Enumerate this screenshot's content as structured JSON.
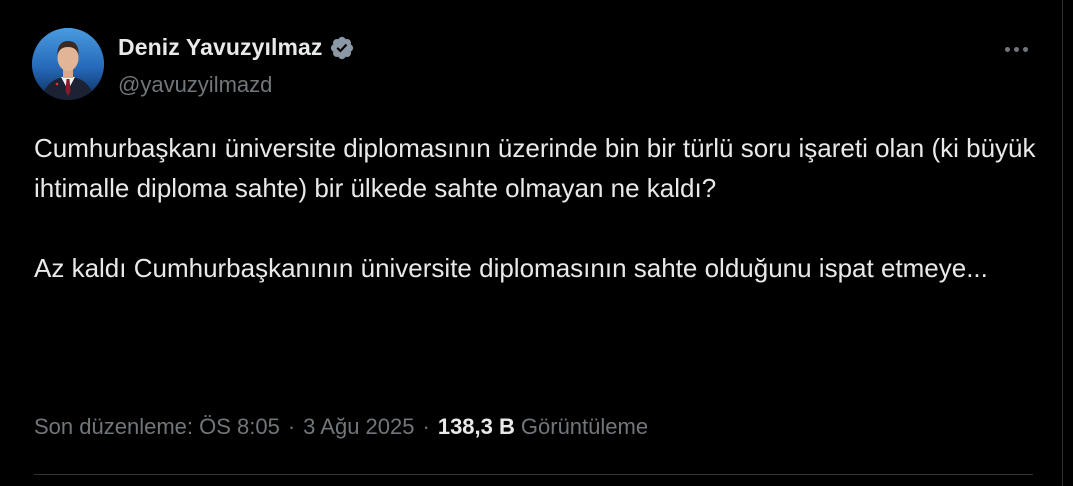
{
  "author": {
    "display_name": "Deniz Yavuzyılmaz",
    "handle": "@yavuzyilmazd",
    "verified": true
  },
  "icons": {
    "avatar": "profile-photo",
    "verified": "verified-badge-icon",
    "more": "more-horizontal-icon"
  },
  "colors": {
    "background": "#000000",
    "text_primary": "#e7e9ea",
    "text_secondary": "#71767b",
    "divider": "#2f3336",
    "verified_badge": "#8b98a5"
  },
  "tweet": {
    "paragraphs": [
      "Cumhurbaşkanı üniversite diplomasının üzerinde bin bir türlü soru işareti olan (ki büyük ihtimalle diploma sahte) bir ülkede sahte olmayan ne kaldı?",
      "Az kaldı Cumhurbaşkanının üniversite diplomasının sahte olduğunu ispat etmeye..."
    ]
  },
  "meta": {
    "edited_label": "Son düzenleme: ÖS 8:05",
    "separator": "·",
    "date": "3 Ağu 2025",
    "views_count": "138,3 B",
    "views_label": "Görüntüleme"
  }
}
